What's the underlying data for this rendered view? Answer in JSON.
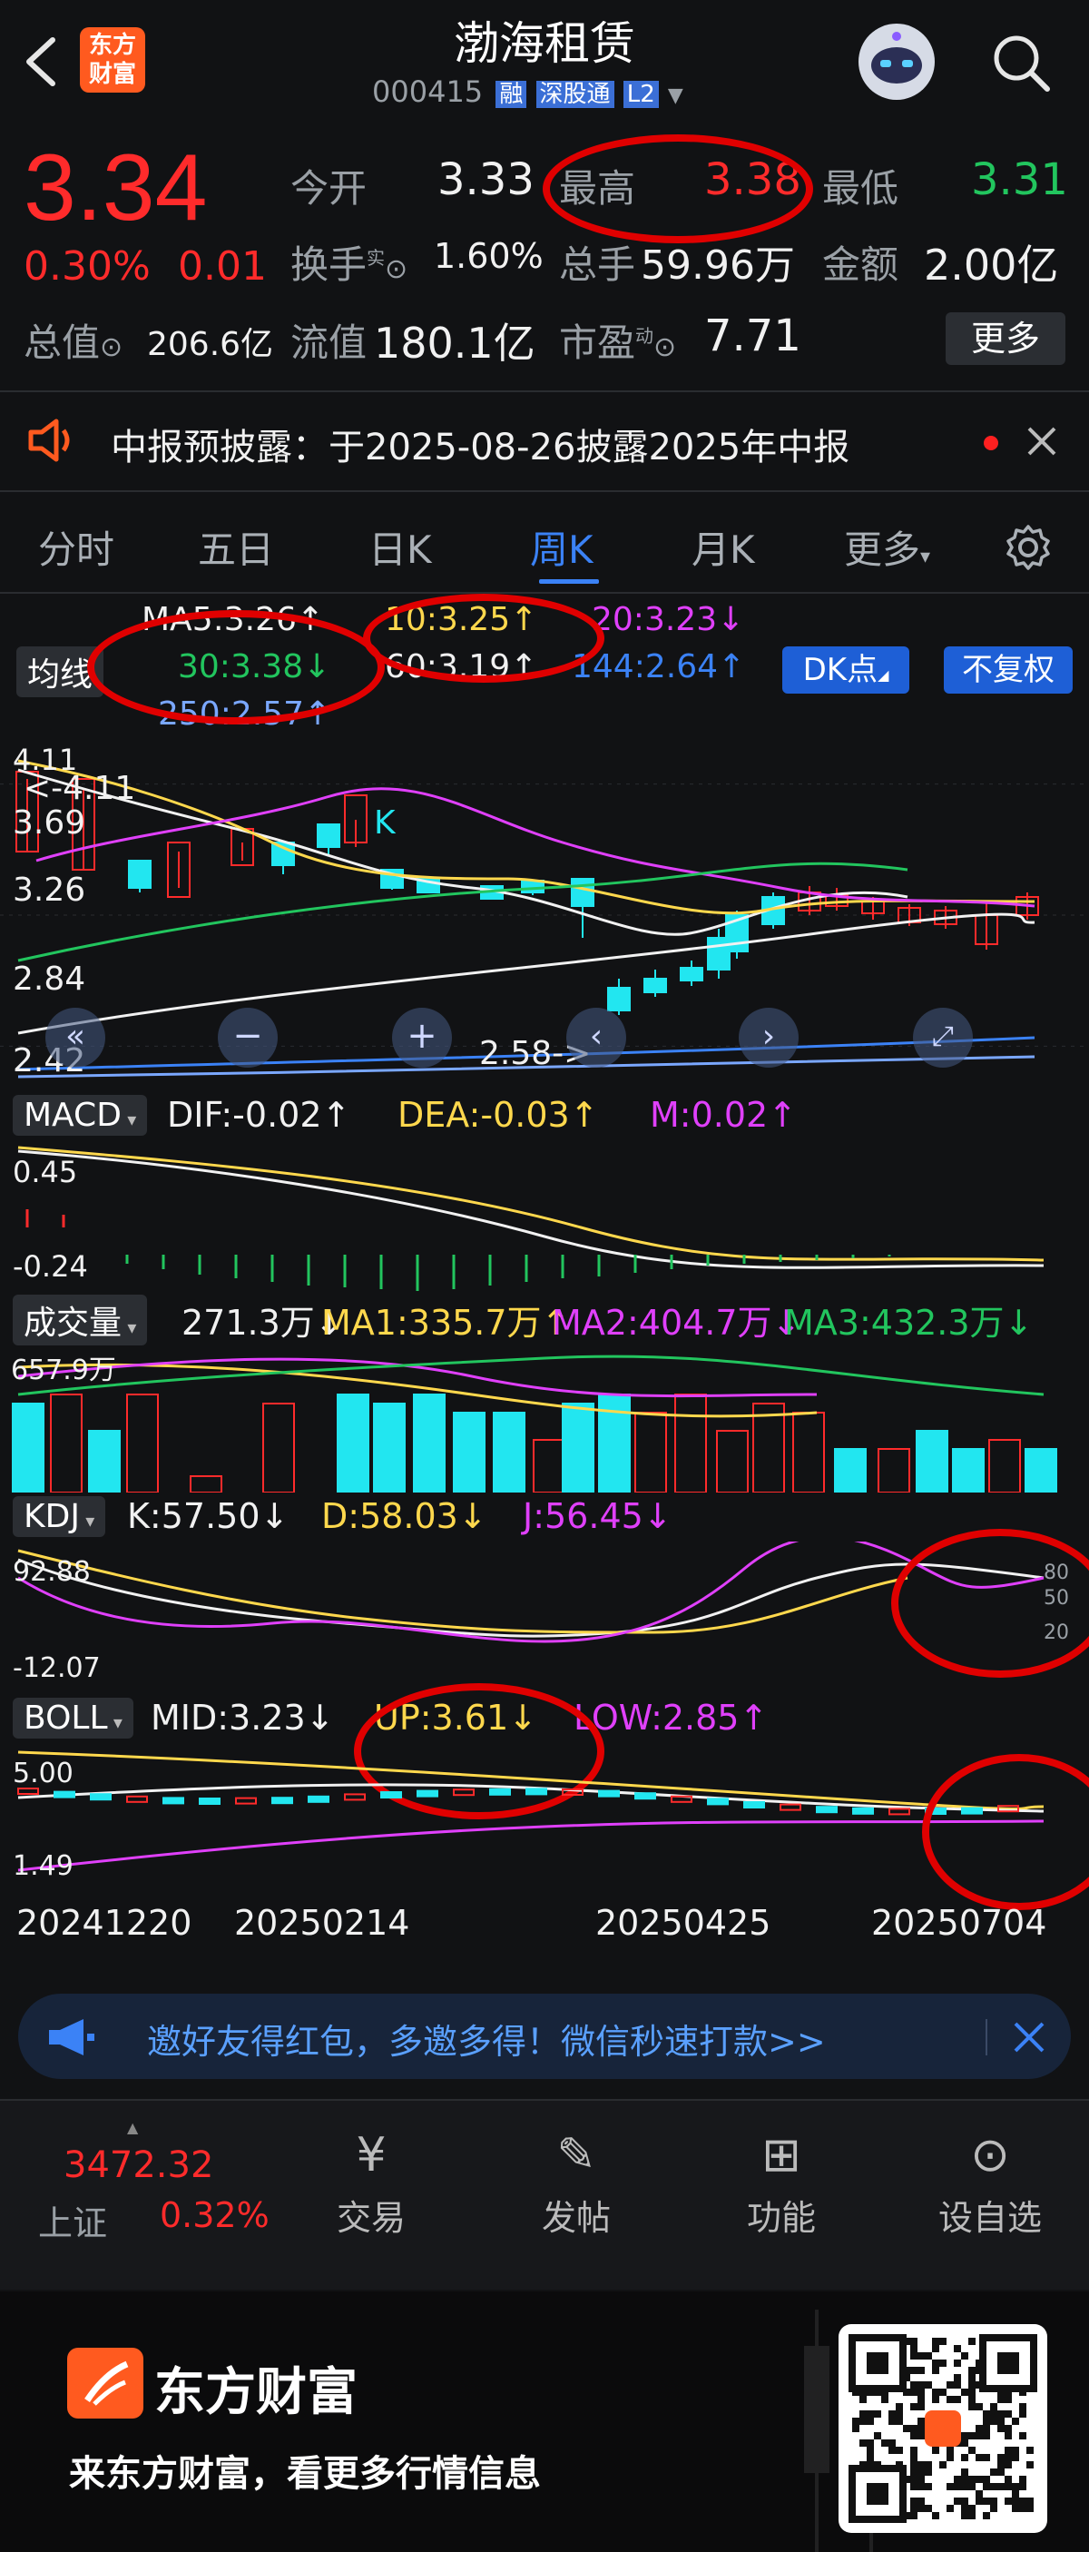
{
  "header": {
    "title": "渤海租赁",
    "code": "000415",
    "badges": [
      "融",
      "深股通",
      "L2"
    ],
    "logo_line1": "东方",
    "logo_line2": "财富"
  },
  "quote": {
    "price": "3.34",
    "change_pct": "0.30%",
    "change": "0.01",
    "open_label": "今开",
    "open": "3.33",
    "high_label": "最高",
    "high": "3.38",
    "low_label": "最低",
    "low": "3.31",
    "turnover_label": "换手",
    "turnover_sup": "实",
    "turnover": "1.60%",
    "volume_label": "总手",
    "volume": "59.96万",
    "amount_label": "金额",
    "amount": "2.00亿",
    "mktcap_label": "总值",
    "mktcap": "206.6亿",
    "float_label": "流值",
    "float_cap": "180.1亿",
    "pe_label": "市盈",
    "pe_sup": "动",
    "pe": "7.71",
    "more": "更多"
  },
  "notice": {
    "text": "中报预披露：于2025-08-26披露2025年中报"
  },
  "tabs": [
    "分时",
    "五日",
    "日K",
    "周K",
    "月K",
    "更多"
  ],
  "active_tab": "周K",
  "ma": {
    "label": "均线",
    "ma5": "MA5:3.26↑",
    "ma10": "10:3.25↑",
    "ma20": "20:3.23↓",
    "ma30": "30:3.38↓",
    "ma60": "60:3.19↑",
    "ma144": "144:2.64↑",
    "ma250": "250:2.57↑",
    "dk": "DK点",
    "fq": "不复权"
  },
  "kline": {
    "axis": [
      "4.11",
      "3.69",
      "3.26",
      "2.84",
      "2.42"
    ],
    "top_note": "<-4.11",
    "bottom_note": "2.58->",
    "k_mark": "K"
  },
  "macd": {
    "label": "MACD",
    "dif": "DIF:-0.02↑",
    "dea": "DEA:-0.03↑",
    "m": "M:0.02↑",
    "axis_top": "0.45",
    "axis_bottom": "-0.24"
  },
  "volume": {
    "label": "成交量",
    "vol": "271.3万↓",
    "ma1": "MA1:335.7万↑",
    "ma2": "MA2:404.7万↓",
    "ma3": "MA3:432.3万↓",
    "axis_top": "657.9万"
  },
  "kdj": {
    "label": "KDJ",
    "k": "K:57.50↓",
    "d": "D:58.03↓",
    "j": "J:56.45↓",
    "axis_top": "92.88",
    "axis_bottom": "-12.07",
    "right_ticks": [
      "80",
      "50",
      "20"
    ]
  },
  "boll": {
    "label": "BOLL",
    "mid": "MID:3.23↓",
    "up": "UP:3.61↓",
    "low": "LOW:2.85↑",
    "axis_top": "5.00",
    "axis_bottom": "1.49"
  },
  "dates": [
    "20241220",
    "20250214",
    "20250425",
    "20250704"
  ],
  "promo": {
    "text": "邀好友得红包，多邀多得！微信秒速打款>>"
  },
  "bottom_nav": {
    "index_value": "3472.32",
    "index_name": "上证",
    "index_change": "0.32%",
    "items": [
      "交易",
      "发帖",
      "功能",
      "设自选"
    ]
  },
  "footer": {
    "brand": "东方财富",
    "slogan": "来东方财富，看更多行情信息"
  },
  "colors": {
    "up": "#ff2b2b",
    "down": "#22e6f0",
    "accent": "#3b82f6",
    "background": "#111214"
  }
}
